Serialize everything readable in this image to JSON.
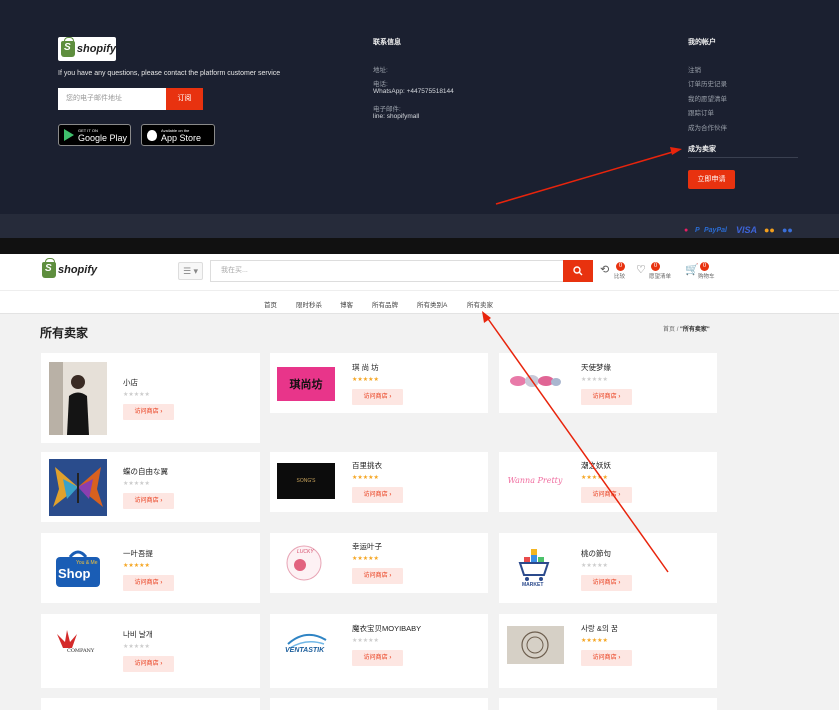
{
  "footer": {
    "logo_text": "shopify",
    "description": "If you have any questions, please contact the platform customer service",
    "email_placeholder": "您的电子邮件地址",
    "subscribe_label": "订阅",
    "google_play": {
      "small": "GET IT ON",
      "big": "Google Play"
    },
    "app_store": {
      "small": "Available on the",
      "big": "App Store"
    },
    "contact": {
      "title": "联系信息",
      "address_label": "地址:",
      "phone_label": "电话:",
      "whatsapp": "WhatsApp: +447575518144",
      "email_label": "电子邮件:",
      "line": "line: shopifymall"
    },
    "account": {
      "title": "我的帐户",
      "links": [
        "注销",
        "订单历史记录",
        "我的愿望清单",
        "跟踪订单",
        "成为合作伙伴"
      ],
      "seller_title": "成为卖家",
      "apply_label": "立即申请"
    },
    "payments": [
      "PayPal",
      "VISA"
    ],
    "colors": {
      "bg": "#1b2030",
      "accent": "#e8320f"
    }
  },
  "header": {
    "logo_text": "shopify",
    "menu_icon": "☰ ▾",
    "search_placeholder": "我在买...",
    "compare_label": "比较",
    "compare_count": "0",
    "wishlist_label": "愿望清单",
    "wishlist_count": "0",
    "cart_label": "购物车",
    "cart_count": "0"
  },
  "nav": [
    "首页",
    "限时秒杀",
    "博客",
    "所有品牌",
    "所有类别A",
    "所有卖家"
  ],
  "page": {
    "title": "所有卖家",
    "breadcrumb_home": "首页",
    "breadcrumb_sep": "/",
    "breadcrumb_current": "\"所有卖家\""
  },
  "visit_label": "访问商店",
  "sellers": [
    {
      "name": "小店",
      "stars": 0
    },
    {
      "name": "琪 尚 坊",
      "stars": 5
    },
    {
      "name": "天使梦缘",
      "stars": 0
    },
    {
      "name": "蝶の自由な翼",
      "stars": 0
    },
    {
      "name": "百里挑衣",
      "stars": 5
    },
    {
      "name": "潮之妖妖",
      "stars": 5
    },
    {
      "name": "一叶吾提",
      "stars": 5
    },
    {
      "name": "幸运叶子",
      "stars": 5
    },
    {
      "name": "桃の節句",
      "stars": 0
    },
    {
      "name": "나비 날개",
      "stars": 0
    },
    {
      "name": "魔衣宝贝MOYIBABY",
      "stars": 0
    },
    {
      "name": "사랑 &의 꿈",
      "stars": 5
    }
  ],
  "thumbs": {
    "t1": "琪尚坊",
    "t5": "SONG'S",
    "t6": "Wanna Pretty",
    "t7a": "You & Me",
    "t7b": "Shop",
    "t8": "LUCKY",
    "t9": "MARKET",
    "t10": "COMPANY",
    "t11": "VENTASTIK"
  }
}
